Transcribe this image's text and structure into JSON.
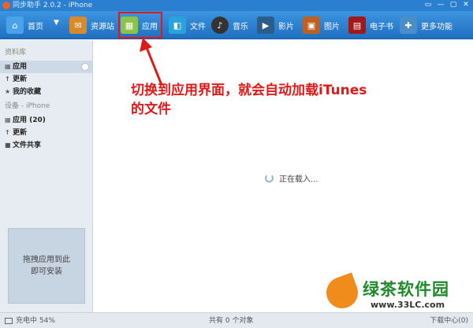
{
  "window": {
    "title": "同步助手 2.0.2 - iPhone",
    "controls": [
      "▭",
      "—",
      "▢",
      "✕"
    ]
  },
  "toolbar": {
    "items": [
      {
        "label": "首页",
        "icon": "home-icon",
        "color": "#4aa3e8"
      },
      {
        "label": "资源站",
        "icon": "resource-icon",
        "color": "#d98a2b"
      },
      {
        "label": "应用",
        "icon": "apps-icon",
        "color": "#8bc34a"
      },
      {
        "label": "文件",
        "icon": "file-icon",
        "color": "#29a3d9"
      },
      {
        "label": "音乐",
        "icon": "music-icon",
        "color": "#333333"
      },
      {
        "label": "影片",
        "icon": "video-icon",
        "color": "#2c5c8a"
      },
      {
        "label": "图片",
        "icon": "picture-icon",
        "color": "#c06020"
      },
      {
        "label": "电子书",
        "icon": "ebook-icon",
        "color": "#a01818"
      },
      {
        "label": "更多功能",
        "icon": "more-icon",
        "color": "#4a8ec9"
      }
    ],
    "active_index": 2
  },
  "sidebar": {
    "library_label": "资料库",
    "library_items": [
      {
        "label": "应用",
        "icon": "grid-icon"
      },
      {
        "label": "更新",
        "icon": "up-arrow-icon"
      },
      {
        "label": "我的收藏",
        "icon": "star-icon"
      }
    ],
    "device_label": "设备 - iPhone",
    "device_items": [
      {
        "label": "应用 (20)",
        "icon": "grid-icon"
      },
      {
        "label": "更新",
        "icon": "up-arrow-icon"
      },
      {
        "label": "文件共享",
        "icon": "folder-icon"
      }
    ],
    "drop_zone_text": [
      "拖拽应用到此",
      "即可安装"
    ]
  },
  "main": {
    "annotation": [
      "切换到应用界面，就会自动加载iTunes",
      "的文件"
    ],
    "loading_text": "正在载入..."
  },
  "watermark": {
    "title": "绿茶软件园",
    "url": "www.33LC.com"
  },
  "statusbar": {
    "charge": "充电中 54%",
    "summary": "共有 0 个对象",
    "download_center": "下载中心(0)"
  },
  "colors": {
    "toolbar": "#2b7fd0",
    "annotation": "#e01818",
    "highlight_box": "#e01818"
  }
}
